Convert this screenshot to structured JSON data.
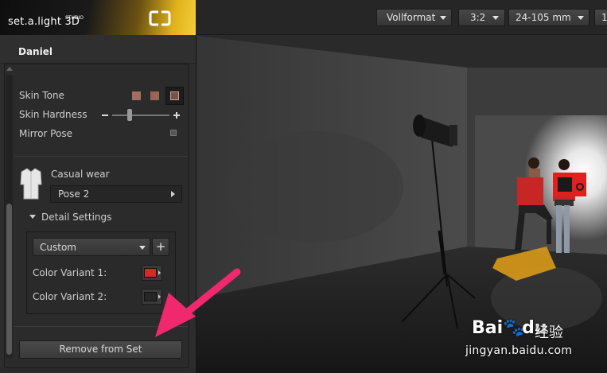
{
  "app": {
    "logo_text": "set.a.light 3D",
    "logo_sub": "STUDIO"
  },
  "toolbar": {
    "sensor": "Vollformat",
    "aspect": "3:2",
    "lens": "24-105 mm",
    "extra": "1"
  },
  "panel": {
    "title": "Daniel",
    "skin_tone_label": "Skin Tone",
    "skin_tone_colors": [
      "#a56d5f",
      "#9b6553",
      "#76524a"
    ],
    "skin_hardness_label": "Skin Hardness",
    "skin_hardness_value": 0.3,
    "mirror_pose_label": "Mirror Pose",
    "clothing_label": "Casual wear",
    "pose_value": "Pose 2",
    "detail_settings_label": "Detail Settings",
    "preset_value": "Custom",
    "add_symbol": "+",
    "color_variant_1_label": "Color Variant 1:",
    "color_variant_1_color": "#d42a2a",
    "color_variant_2_label": "Color Variant 2:",
    "color_variant_2_color": "#262626",
    "remove_label": "Remove from Set"
  },
  "watermark": {
    "brand": "Bai",
    "brand2": "du",
    "cn": "经验",
    "url": "jingyan.baidu.com"
  },
  "colors": {
    "accent_gold": "#e0b21c",
    "annotation_pink": "#f0286e"
  }
}
